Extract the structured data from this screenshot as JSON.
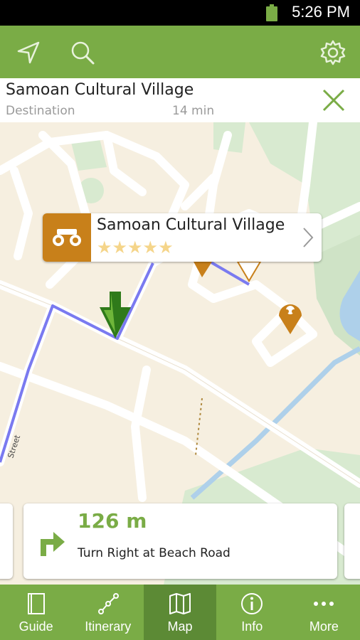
{
  "status_bar": {
    "time": "5:26 PM"
  },
  "toolbar": {
    "left_icons": [
      "navigate-icon",
      "search-icon"
    ],
    "right_icon": "gear-icon"
  },
  "destination": {
    "name": "Samoan Cultural Village",
    "label": "Destination",
    "eta": "14 min"
  },
  "map": {
    "street_label": "Street",
    "poi_card": {
      "name": "Samoan Cultural Village",
      "rating": 5,
      "rating_max": 5,
      "stars": "★★★★★"
    }
  },
  "navigation": {
    "distance": "126 m",
    "instruction": "Turn Right at Beach Road"
  },
  "tabs": [
    {
      "label": "Guide",
      "icon": "book-icon"
    },
    {
      "label": "Itinerary",
      "icon": "route-icon"
    },
    {
      "label": "Map",
      "icon": "map-icon",
      "active": true
    },
    {
      "label": "Info",
      "icon": "info-icon"
    },
    {
      "label": "More",
      "icon": "more-icon"
    }
  ],
  "colors": {
    "accent": "#7aac46",
    "accent_dark": "#5c8a35",
    "poi": "#c8801a",
    "route": "#7a7af0"
  }
}
